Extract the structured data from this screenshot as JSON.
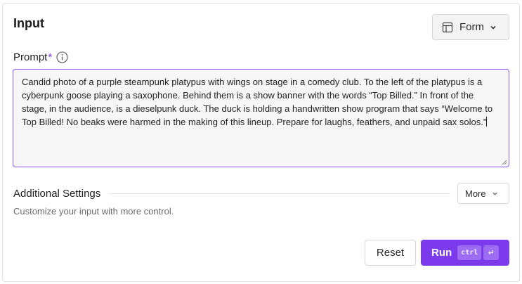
{
  "panel": {
    "title": "Input",
    "layout_button": {
      "label": "Form",
      "icon": "layout-icon"
    }
  },
  "prompt": {
    "label": "Prompt",
    "required_mark": "*",
    "info_icon": "info-icon",
    "value": "Candid photo of a purple steampunk platypus with wings on stage in a comedy club. To the left of the platypus is a cyberpunk goose playing a saxophone. Behind them is a show banner with the words “Top Billed.” In front of the stage, in the audience, is a dieselpunk duck. The duck is holding a handwritten show program that says “Welcome to Top Billed! No beaks were harmed in the making of this lineup. Prepare for laughs, feathers, and unpaid sax solos.”"
  },
  "additional_settings": {
    "title": "Additional Settings",
    "more_label": "More",
    "description": "Customize your input with more control."
  },
  "actions": {
    "reset_label": "Reset",
    "run_label": "Run",
    "shortcut_key": "ctrl",
    "shortcut_enter": "↵"
  },
  "colors": {
    "accent": "#7c3aed",
    "prompt_border": "#8b5cf6"
  }
}
